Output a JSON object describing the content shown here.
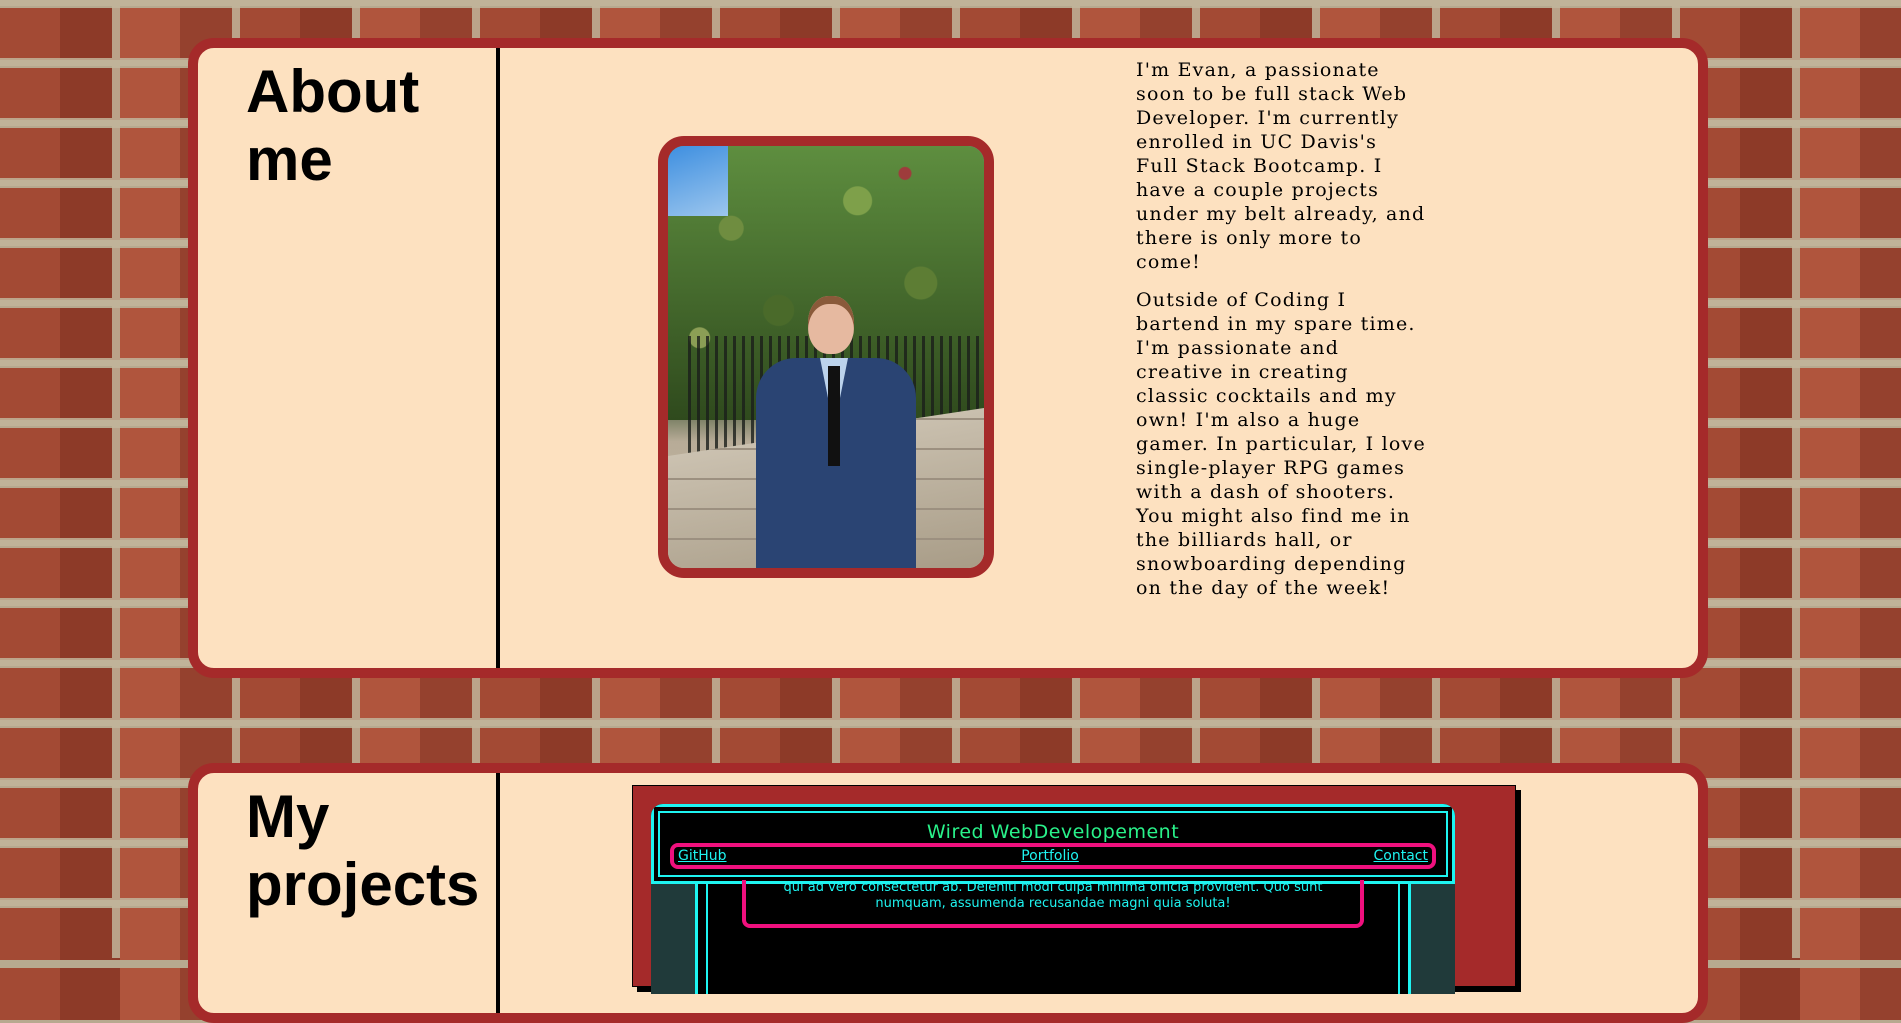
{
  "about": {
    "heading": "About me",
    "bio": [
      "I'm Evan, a passionate soon to be full stack Web Developer. I'm currently enrolled in UC Davis's Full Stack Bootcamp. I have a couple projects under my belt already, and there is only more to come!",
      "Outside of Coding I bartend in my spare time. I'm passionate and creative in creating classic cocktails and my own! I'm also a huge gamer. In particular, I love single-player RPG games with a dash of shooters. You might also find me in the billiards hall, or snowboarding depending on the day of the week!"
    ]
  },
  "projects": {
    "heading": "My projects",
    "preview": {
      "site_title": "Wired WebDevelopement",
      "nav": [
        "GitHub",
        "Portfolio",
        "Contact"
      ],
      "text": "qui ad vero consectetur ab. Deleniti modi culpa minima officia provident. Quo sunt numquam, assumenda recusandae magni quia soluta!"
    }
  },
  "colors": {
    "card_bg": "#fde1c0",
    "card_border": "#a52a2a",
    "neon_cyan": "#1ef4f1",
    "neon_pink": "#f0107e",
    "neon_green": "#29f28a"
  }
}
